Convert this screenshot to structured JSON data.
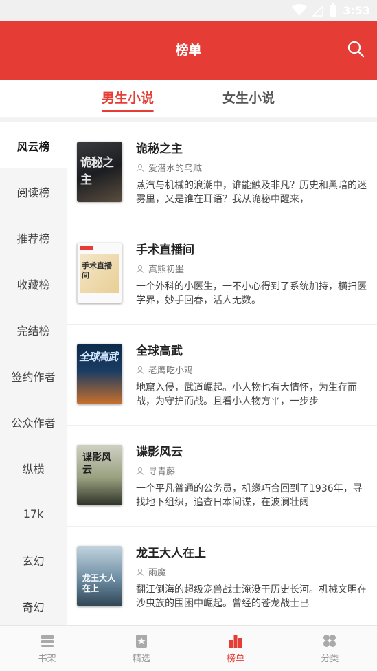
{
  "status_bar": {
    "time": "3:53"
  },
  "header": {
    "title": "榜单"
  },
  "gender_tabs": [
    {
      "label": "男生小说",
      "active": true
    },
    {
      "label": "女生小说",
      "active": false
    }
  ],
  "sidebar": {
    "items": [
      {
        "label": "风云榜",
        "active": true
      },
      {
        "label": "阅读榜"
      },
      {
        "label": "推荐榜"
      },
      {
        "label": "收藏榜"
      },
      {
        "label": "完结榜"
      },
      {
        "label": "签约作者"
      },
      {
        "label": "公众作者"
      },
      {
        "label": "纵横"
      },
      {
        "label": "17k"
      },
      {
        "label": "玄幻"
      },
      {
        "label": "奇幻"
      }
    ]
  },
  "books": [
    {
      "title": "诡秘之主",
      "author": "爱潜水的乌贼",
      "description": "蒸汽与机械的浪潮中，谁能触及非凡？历史和黑暗的迷雾里，又是谁在耳语？我从诡秘中醒来，",
      "cover_text": "诡秘之主"
    },
    {
      "title": "手术直播间",
      "author": "真熊初墨",
      "description": "一个外科的小医生，一不小心得到了系统加持，横扫医学界，妙手回春，活人无数。",
      "cover_text": "手术直播间"
    },
    {
      "title": "全球高武",
      "author": "老鹰吃小鸡",
      "description": "地窟入侵，武道崛起。小人物也有大情怀，为生存而战，为守护而战。且看小人物方平，一步步",
      "cover_text": "全球高武"
    },
    {
      "title": "谍影风云",
      "author": "寻青藤",
      "description": "一个平凡普通的公务员，机缘巧合回到了1936年，寻找地下组织，追查日本间谍，在波澜壮阔",
      "cover_text": "谍影风云"
    },
    {
      "title": "龙王大人在上",
      "author": "雨魔",
      "description": "翻江倒海的超级宠兽战士淹没于历史长河。机械文明在沙虫族的围困中崛起。曾经的苍龙战士已",
      "cover_text": "龙王大人在上"
    }
  ],
  "bottom_nav": [
    {
      "label": "书架",
      "icon": "bookshelf-icon",
      "active": false
    },
    {
      "label": "精选",
      "icon": "featured-icon",
      "active": false
    },
    {
      "label": "榜单",
      "icon": "ranking-icon",
      "active": true
    },
    {
      "label": "分类",
      "icon": "category-icon",
      "active": false
    }
  ],
  "colors": {
    "accent": "#e53d35",
    "sidebar_bg": "#f5f5f5"
  }
}
